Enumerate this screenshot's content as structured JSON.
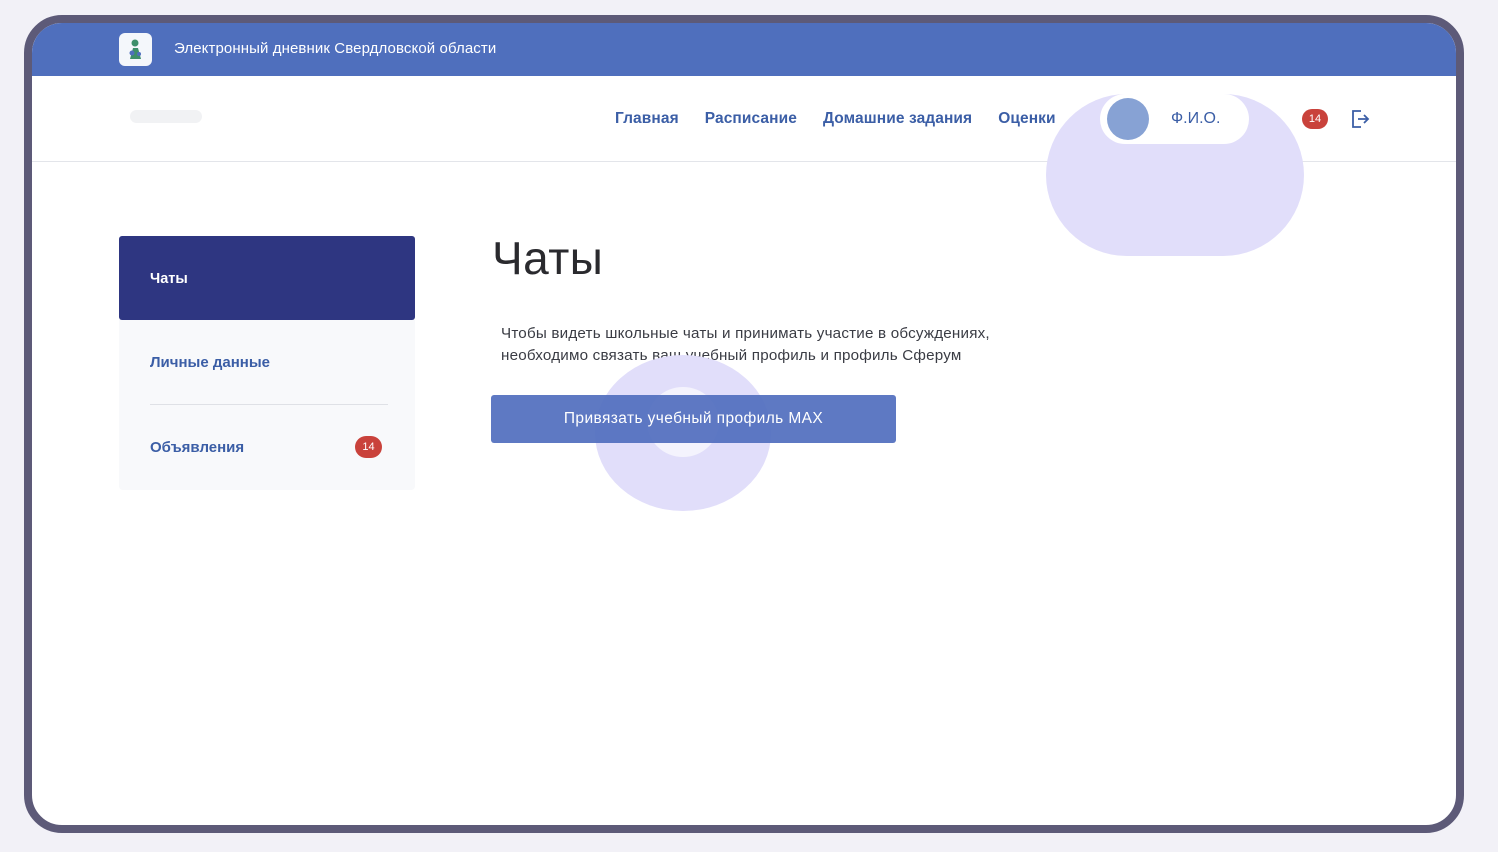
{
  "header": {
    "logo_icon": "region-emblem-icon",
    "app_title": "Электронный дневник Свердловской области"
  },
  "nav": {
    "links": [
      "Главная",
      "Расписание",
      "Домашние задания",
      "Оценки"
    ],
    "profile_name": "Ф.И.О.",
    "notifications_count": "14",
    "logout_icon": "logout-icon"
  },
  "sidebar": {
    "items": [
      {
        "label": "Чаты",
        "active": true
      },
      {
        "label": "Личные данные"
      },
      {
        "label": "Объявления",
        "badge": "14"
      }
    ]
  },
  "main": {
    "title": "Чаты",
    "description_line1": "Чтобы видеть школьные чаты и принимать участие в обсуждениях,",
    "description_line2": "необходимо связать ваш учебный профиль и профиль Сферум",
    "button_label": "Привязать учебный профиль MAX"
  },
  "colors": {
    "header": "#4f6fbd",
    "accent": "#3b5ea6",
    "sidebar_active": "#2e3681",
    "badge": "#c9423b",
    "highlight": "#e1defa"
  }
}
